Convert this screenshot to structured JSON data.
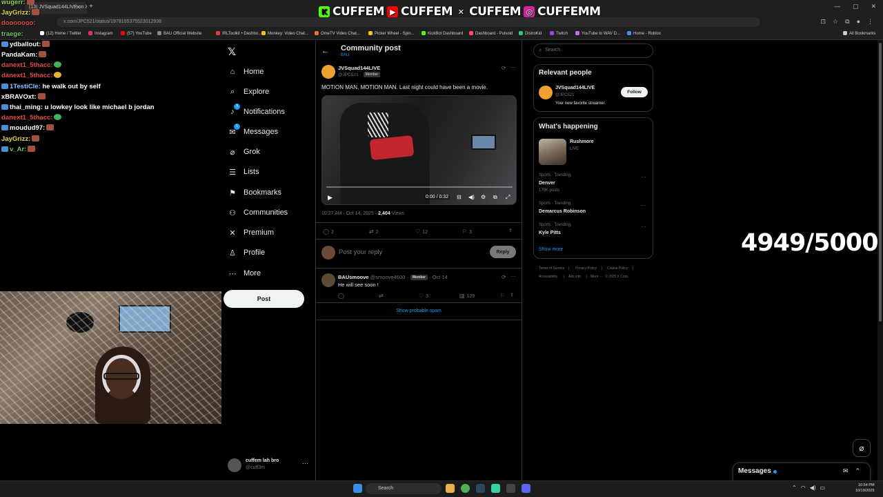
{
  "browser": {
    "tab_title": "(13) JVSquad144LIVE on X: \"MO",
    "url": "x.com/JPC521/status/1978105375523012938",
    "bookmarks": [
      {
        "label": "(12) Home / Twitter",
        "color": "#ffffff"
      },
      {
        "label": "Instagram",
        "color": "#e1306c"
      },
      {
        "label": "(57) YouTube",
        "color": "#ff0000"
      },
      {
        "label": "BAU Official Website",
        "color": "#888888"
      },
      {
        "label": "IRLToolkit • Dashbo...",
        "color": "#e23b3b"
      },
      {
        "label": "Monkey: Video Chat...",
        "color": "#f5c518"
      },
      {
        "label": "OmeTV Video Chat...",
        "color": "#ff6a3d"
      },
      {
        "label": "Picker Wheel - Spin...",
        "color": "#f2c230"
      },
      {
        "label": "KickBot Dashboard",
        "color": "#53fc18"
      },
      {
        "label": "Dashboard - Pulsoid",
        "color": "#ff4d6d"
      },
      {
        "label": "DistroKid",
        "color": "#2ecc71"
      },
      {
        "label": "Twitch",
        "color": "#9146ff"
      },
      {
        "label": "YouTube to WAV D...",
        "color": "#c06cff"
      },
      {
        "label": "Home - Roblox",
        "color": "#4a90e2"
      },
      {
        "label": "All Bookmarks",
        "color": "#cccccc"
      }
    ]
  },
  "banner": {
    "items": [
      {
        "icon": "kick",
        "text": "CUFFEM"
      },
      {
        "icon": "youtube",
        "text": "CUFFEM"
      },
      {
        "icon": "x",
        "text": "CUFFEM"
      },
      {
        "icon": "instagram",
        "text": "CUFFEMM"
      }
    ]
  },
  "chat": [
    {
      "user": "wugerr:",
      "msg": "",
      "color": "#8fd14f",
      "badge": false,
      "emote": "r"
    },
    {
      "user": "JayGrizz:",
      "msg": "",
      "color": "#e5d94a",
      "badge": false,
      "emote": "r"
    },
    {
      "user": "dooooooo:",
      "msg": "",
      "color": "#e34a4a",
      "badge": false,
      "emote": ""
    },
    {
      "user": "traege:",
      "msg": "",
      "color": "#6fc36a",
      "badge": false,
      "emote": ""
    },
    {
      "user": "ydballout:",
      "msg": "",
      "color": "#ffffff",
      "badge": true,
      "emote": "r"
    },
    {
      "user": "PandaKam:",
      "msg": "",
      "color": "#ffffff",
      "badge": false,
      "emote": "r"
    },
    {
      "user": "danext1_5thacc:",
      "msg": "",
      "color": "#e34a4a",
      "badge": false,
      "emote": "g"
    },
    {
      "user": "danext1_5thacc:",
      "msg": "",
      "color": "#e34a4a",
      "badge": false,
      "emote": "y"
    },
    {
      "user": "1TestiCle:",
      "msg": "he walk out by self",
      "color": "#8fc3ff",
      "badge": true,
      "emote": ""
    },
    {
      "user": "xBRAVOxt:",
      "msg": "",
      "color": "#ffffff",
      "badge": false,
      "emote": "r"
    },
    {
      "user": "thai_ming:",
      "msg": "u lowkey look like michael b jordan",
      "color": "#ffffff",
      "badge": true,
      "emote": ""
    },
    {
      "user": "danext1_5thacc:",
      "msg": "",
      "color": "#e34a4a",
      "badge": false,
      "emote": "g"
    },
    {
      "user": "moudud97:",
      "msg": "",
      "color": "#ffffff",
      "badge": true,
      "emote": "r"
    },
    {
      "user": "JayGrizz:",
      "msg": "",
      "color": "#e5d94a",
      "badge": false,
      "emote": "r"
    },
    {
      "user": "v_Ar:",
      "msg": "",
      "color": "#6fc36a",
      "badge": true,
      "emote": "r"
    }
  ],
  "nav": {
    "items": [
      {
        "label": "Home",
        "icon": "home-icon",
        "glyph": "⌂"
      },
      {
        "label": "Explore",
        "icon": "search-icon",
        "glyph": "⌕"
      },
      {
        "label": "Notifications",
        "icon": "bell-icon",
        "glyph": "♪",
        "badge": "3"
      },
      {
        "label": "Messages",
        "icon": "mail-icon",
        "glyph": "✉",
        "badge": "1"
      },
      {
        "label": "Grok",
        "icon": "grok-icon",
        "glyph": "⌀"
      },
      {
        "label": "Lists",
        "icon": "list-icon",
        "glyph": "☰"
      },
      {
        "label": "Bookmarks",
        "icon": "bookmark-icon",
        "glyph": "⚑"
      },
      {
        "label": "Communities",
        "icon": "people-icon",
        "glyph": "⚇"
      },
      {
        "label": "Premium",
        "icon": "x-icon",
        "glyph": "✕"
      },
      {
        "label": "Profile",
        "icon": "person-icon",
        "glyph": "♙"
      },
      {
        "label": "More",
        "icon": "more-icon",
        "glyph": "⋯"
      }
    ],
    "post_label": "Post",
    "account_name": "cuffem lah bro",
    "account_handle": "@cuff3m"
  },
  "post": {
    "header_title": "Community post",
    "header_sub": "BAU",
    "author_name": "JVSquad144LIVE",
    "author_handle": "@JPC521 ·",
    "member_badge": "Member",
    "text": "MOTION MAN, MOTION MAN. Last night could have been a movie.",
    "video_time": "0:00 / 0:32",
    "timestamp": "10:27 AM · Oct 14, 2025 ·",
    "views_count": "2,404",
    "views_label": "Views",
    "actions": {
      "replies": "2",
      "reposts": "2",
      "likes": "12",
      "bookmarks": "3"
    },
    "reply_placeholder": "Post your reply",
    "reply_button": "Reply"
  },
  "reply": {
    "author_name": "BAUsmoove",
    "author_handle": "@smoove4600 ·",
    "member_badge": "Member",
    "date": "· Oct 14",
    "text": "He will see soon !",
    "actions": {
      "replies": "",
      "reposts": "",
      "likes": "3",
      "views": "129"
    }
  },
  "spam_link": "Show probable spam",
  "sidebar": {
    "search_placeholder": "Search",
    "relevant_title": "Relevant people",
    "person_name": "JVSquad144LIVE",
    "person_handle": "@JPC521",
    "person_bio": "Your new favorite streamer.",
    "follow_label": "Follow",
    "happening_title": "What's happening",
    "live_name": "Rushmore",
    "live_status": "LIVE",
    "trends": [
      {
        "context": "Sports · Trending",
        "name": "Denver",
        "posts": "179K posts"
      },
      {
        "context": "Sports · Trending",
        "name": "Demarcus Robinson",
        "posts": ""
      },
      {
        "context": "Sports · Trending",
        "name": "Kyle Pitts",
        "posts": ""
      }
    ],
    "show_more": "Show more",
    "footer": [
      "Terms of Service",
      "|",
      "Privacy Policy",
      "|",
      "Cookie Policy",
      "|",
      "Accessibility",
      "|",
      "Ads info",
      "|",
      "More ···",
      "© 2025 X Corp."
    ]
  },
  "overlay": {
    "counter": "4949/5000"
  },
  "messages_drawer": {
    "title": "Messages"
  },
  "taskbar": {
    "search_label": "Search",
    "time": "10:54 PM",
    "date": "10/19/2025"
  }
}
